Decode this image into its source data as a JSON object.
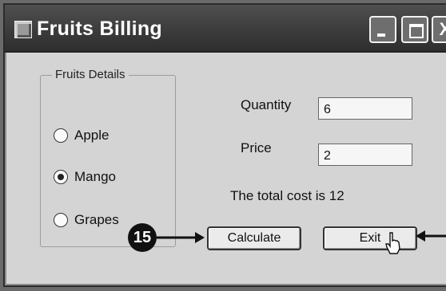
{
  "window": {
    "title": "Fruits Billing"
  },
  "title_buttons": {
    "minimize": "minimize-icon",
    "maximize": "maximize-icon",
    "close_glyph": "X"
  },
  "fruits": {
    "legend": "Fruits Details",
    "options": [
      {
        "label": "Apple",
        "selected": false
      },
      {
        "label": "Mango",
        "selected": true
      },
      {
        "label": "Grapes",
        "selected": false
      }
    ]
  },
  "form": {
    "quantity_label": "Quantity",
    "quantity_value": "6",
    "price_label": "Price",
    "price_value": "2",
    "total_text": "The total cost is 12"
  },
  "buttons": {
    "calculate": "Calculate",
    "exit": "Exit"
  },
  "annotation": {
    "step_number": "15"
  }
}
